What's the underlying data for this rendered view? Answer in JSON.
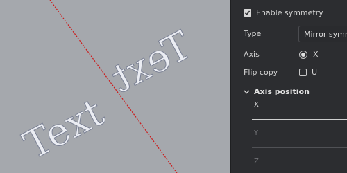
{
  "canvas": {
    "background": "#a5a8ad",
    "text_original": "Text",
    "text_mirrored": "Text",
    "axis_color": "#d01818"
  },
  "panel": {
    "enable_symmetry": {
      "label": "Enable symmetry",
      "checked": true
    },
    "type": {
      "label": "Type",
      "value": "Mirror symm"
    },
    "axis": {
      "label": "Axis",
      "option_x": "X"
    },
    "flip_copy": {
      "label": "Flip copy",
      "option_u": "U"
    },
    "axis_position": {
      "header": "Axis position",
      "fields": [
        {
          "label": "X",
          "active": true
        },
        {
          "label": "Y",
          "active": false
        },
        {
          "label": "Z",
          "active": false
        }
      ]
    }
  }
}
